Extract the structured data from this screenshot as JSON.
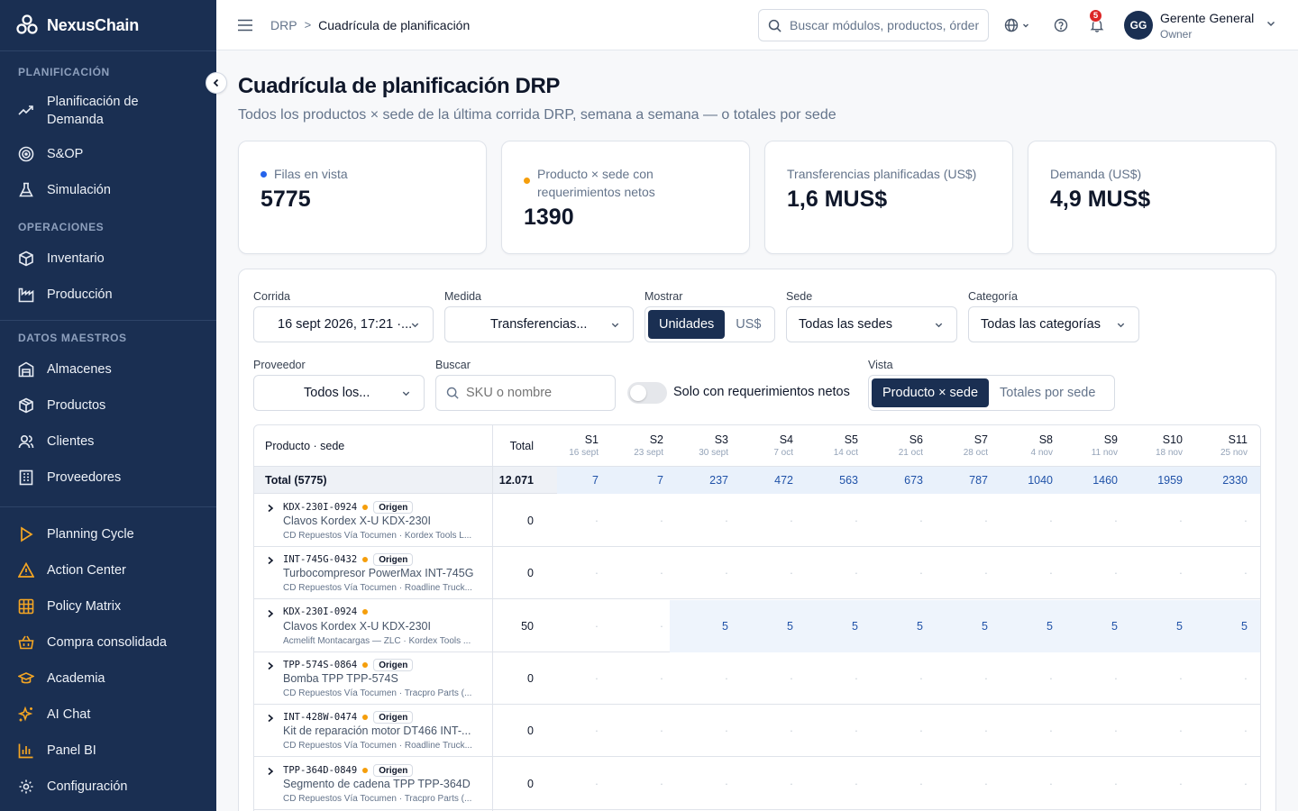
{
  "brand": {
    "name": "NexusChain"
  },
  "sidebar": {
    "sections": [
      {
        "heading": "PLANIFICACIÓN",
        "items": [
          {
            "label": "Planificación de Demanda",
            "icon": "trend-up-icon"
          },
          {
            "label": "S&OP",
            "icon": "target-icon"
          },
          {
            "label": "Simulación",
            "icon": "flask-icon"
          }
        ]
      },
      {
        "heading": "OPERACIONES",
        "items": [
          {
            "label": "Inventario",
            "icon": "box-icon"
          },
          {
            "label": "Producción",
            "icon": "factory-icon"
          }
        ]
      },
      {
        "heading": "DATOS MAESTROS",
        "items": [
          {
            "label": "Almacenes",
            "icon": "warehouse-icon"
          },
          {
            "label": "Productos",
            "icon": "package-icon"
          },
          {
            "label": "Clientes",
            "icon": "users-icon"
          },
          {
            "label": "Proveedores",
            "icon": "building-icon"
          }
        ]
      }
    ],
    "extra_items": [
      {
        "label": "Planning Cycle",
        "icon": "play-icon"
      },
      {
        "label": "Action Center",
        "icon": "warning-icon"
      },
      {
        "label": "Policy Matrix",
        "icon": "grid-icon"
      },
      {
        "label": "Compra consolidada",
        "icon": "basket-icon"
      },
      {
        "label": "Academia",
        "icon": "graduation-icon"
      },
      {
        "label": "AI Chat",
        "icon": "sparkle-icon"
      },
      {
        "label": "Panel BI",
        "icon": "bar-chart-icon"
      },
      {
        "label": "Configuración",
        "icon": "gear-icon"
      }
    ],
    "accent_color": "#f5a623"
  },
  "topbar": {
    "breadcrumb_root": "DRP",
    "breadcrumb_sep": ">",
    "breadcrumb_current": "Cuadrícula de planificación",
    "search_placeholder": "Buscar módulos, productos, órdenes...",
    "notification_count": "5",
    "user_initials": "GG",
    "user_name": "Gerente General",
    "user_role": "Owner"
  },
  "page": {
    "title": "Cuadrícula de planificación DRP",
    "subtitle": "Todos los productos × sede de la última corrida DRP, semana a semana — o totales por sede"
  },
  "kpis": [
    {
      "label": "Filas en vista",
      "value": "5775",
      "dot_color": "#2563eb"
    },
    {
      "label": "Producto × sede con requerimientos netos",
      "value": "1390",
      "dot_color": "#f59e0b"
    },
    {
      "label": "Transferencias planificadas (US$)",
      "value": "1,6 MUS$"
    },
    {
      "label": "Demanda (US$)",
      "value": "4,9 MUS$"
    }
  ],
  "filters": {
    "run_label": "Corrida",
    "run_value": "16 sept 2026, 17:21 ·...",
    "measure_label": "Medida",
    "measure_value": "Transferencias...",
    "show_label": "Mostrar",
    "show_options": [
      "Unidades",
      "US$"
    ],
    "show_active": "Unidades",
    "site_label": "Sede",
    "site_value": "Todas las sedes",
    "category_label": "Categoría",
    "category_value": "Todas las categorías",
    "supplier_label": "Proveedor",
    "supplier_value": "Todos los...",
    "search_label": "Buscar",
    "search_placeholder": "SKU o nombre",
    "only_net_req_label": "Solo con requerimientos netos",
    "view_label": "Vista",
    "view_options": [
      "Producto × sede",
      "Totales por sede"
    ],
    "view_active": "Producto × sede"
  },
  "grid": {
    "product_header": "Producto · sede",
    "total_header": "Total",
    "weeks": [
      {
        "name": "S1",
        "date": "16 sept"
      },
      {
        "name": "S2",
        "date": "23 sept"
      },
      {
        "name": "S3",
        "date": "30 sept"
      },
      {
        "name": "S4",
        "date": "7 oct"
      },
      {
        "name": "S5",
        "date": "14 oct"
      },
      {
        "name": "S6",
        "date": "21 oct"
      },
      {
        "name": "S7",
        "date": "28 oct"
      },
      {
        "name": "S8",
        "date": "4 nov"
      },
      {
        "name": "S9",
        "date": "11 nov"
      },
      {
        "name": "S10",
        "date": "18 nov"
      },
      {
        "name": "S11",
        "date": "25 nov"
      }
    ],
    "total_row": {
      "label": "Total (5775)",
      "total": "12.071",
      "values": [
        "7",
        "7",
        "237",
        "472",
        "563",
        "673",
        "787",
        "1040",
        "1460",
        "1959",
        "2330"
      ]
    },
    "rows": [
      {
        "sku": "KDX-230I-0924",
        "origin": "Origen",
        "name": "Clavos Kordex X-U KDX-230I",
        "meta": "CD Repuestos Vía Tocumen · Kordex Tools L...",
        "total": "0",
        "values": [
          "·",
          "·",
          "·",
          "·",
          "·",
          "·",
          "·",
          "·",
          "·",
          "·",
          "·"
        ]
      },
      {
        "sku": "INT-745G-0432",
        "origin": "Origen",
        "name": "Turbocompresor PowerMax INT-745G",
        "meta": "CD Repuestos Vía Tocumen · Roadline Truck...",
        "total": "0",
        "values": [
          "·",
          "·",
          "·",
          "·",
          "·",
          "·",
          "·",
          "·",
          "·",
          "·",
          "·"
        ]
      },
      {
        "sku": "KDX-230I-0924",
        "origin": "",
        "name": "Clavos Kordex X-U KDX-230I",
        "meta": "Acmelift Montacargas — ZLC · Kordex Tools ...",
        "total": "50",
        "values": [
          "·",
          "·",
          "5",
          "5",
          "5",
          "5",
          "5",
          "5",
          "5",
          "5",
          "5"
        ],
        "highlight_from": 2
      },
      {
        "sku": "TPP-574S-0864",
        "origin": "Origen",
        "name": "Bomba TPP TPP-574S",
        "meta": "CD Repuestos Vía Tocumen · Tracpro Parts (...",
        "total": "0",
        "values": [
          "·",
          "·",
          "·",
          "·",
          "·",
          "·",
          "·",
          "·",
          "·",
          "·",
          "·"
        ]
      },
      {
        "sku": "INT-428W-0474",
        "origin": "Origen",
        "name": "Kit de reparación motor DT466 INT-...",
        "meta": "CD Repuestos Vía Tocumen · Roadline Truck...",
        "total": "0",
        "values": [
          "·",
          "·",
          "·",
          "·",
          "·",
          "·",
          "·",
          "·",
          "·",
          "·",
          "·"
        ]
      },
      {
        "sku": "TPP-364D-0849",
        "origin": "Origen",
        "name": "Segmento de cadena TPP TPP-364D",
        "meta": "CD Repuestos Vía Tocumen · Tracpro Parts (...",
        "total": "0",
        "values": [
          "·",
          "·",
          "·",
          "·",
          "·",
          "·",
          "·",
          "·",
          "·",
          "·",
          "·"
        ]
      }
    ]
  }
}
